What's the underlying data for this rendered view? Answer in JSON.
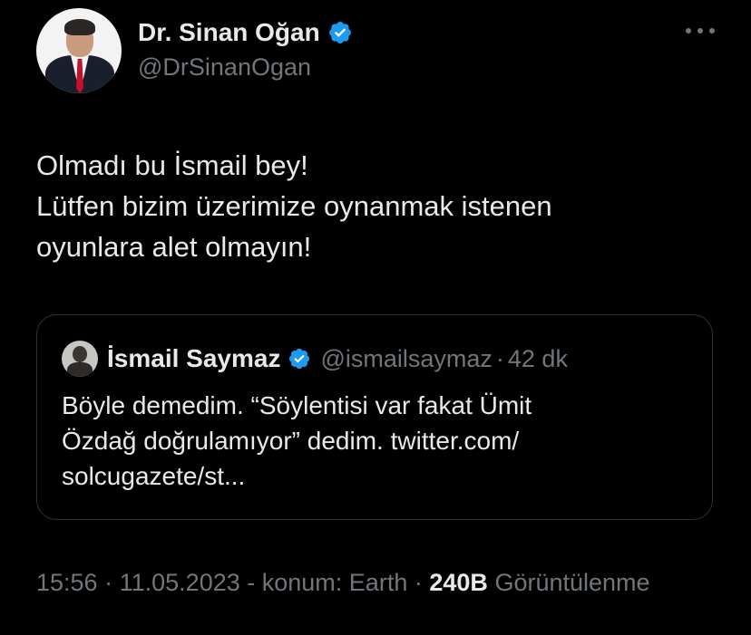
{
  "author": {
    "display_name": "Dr. Sinan Oğan",
    "handle": "@DrSinanOgan",
    "avatar_icon": "profile-photo",
    "verified_icon": "verified-badge-icon",
    "verified_color": "#1d9bf0"
  },
  "menu": {
    "more_icon": "more-horizontal-icon"
  },
  "tweet": {
    "lines": [
      "Olmadı bu İsmail bey!",
      "Lütfen bizim üzerimize oynanmak istenen",
      "oyunlara alet olmayın!"
    ]
  },
  "quote": {
    "display_name": "İsmail Saymaz",
    "handle": "@ismailsaymaz",
    "separator": "·",
    "time": "42 dk",
    "lines": [
      "Böyle demedim. “Söylentisi var fakat Ümit",
      "Özdağ doğrulamıyor” dedim. twitter.com/",
      "solcugazete/st..."
    ]
  },
  "meta": {
    "time": "15:56",
    "separator": "·",
    "date": "11.05.2023",
    "location": "- konum: Earth",
    "views_count": "240B",
    "views_label": "Görüntülenme"
  },
  "colors": {
    "background": "#000000",
    "text_primary": "#e7e9ea",
    "text_secondary": "#71767b",
    "border": "#2f3336",
    "verified": "#1d9bf0"
  }
}
